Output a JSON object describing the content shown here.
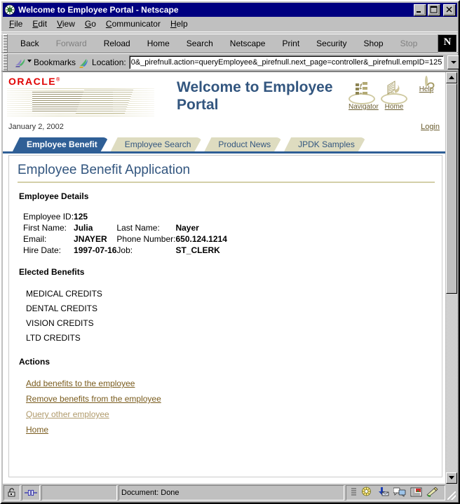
{
  "window": {
    "title": "Welcome to Employee Portal - Netscape",
    "minimize_label": "Minimize",
    "maximize_label": "Maximize",
    "close_label": "Close"
  },
  "menubar": {
    "items": [
      {
        "label": "File",
        "accel": "F"
      },
      {
        "label": "Edit",
        "accel": "E"
      },
      {
        "label": "View",
        "accel": "V"
      },
      {
        "label": "Go",
        "accel": "G"
      },
      {
        "label": "Communicator",
        "accel": "C"
      },
      {
        "label": "Help",
        "accel": "H"
      }
    ]
  },
  "toolbar": {
    "buttons": [
      {
        "label": "Back",
        "disabled": false
      },
      {
        "label": "Forward",
        "disabled": true
      },
      {
        "label": "Reload",
        "disabled": false
      },
      {
        "label": "Home",
        "disabled": false
      },
      {
        "label": "Search",
        "disabled": false
      },
      {
        "label": "Netscape",
        "disabled": false
      },
      {
        "label": "Print",
        "disabled": false
      },
      {
        "label": "Security",
        "disabled": false
      },
      {
        "label": "Shop",
        "disabled": false
      },
      {
        "label": "Stop",
        "disabled": true
      }
    ],
    "brand_letter": "N"
  },
  "locationbar": {
    "bookmarks_label": "Bookmarks",
    "location_label": "Location:",
    "url": "0&_pirefnull.action=queryEmployee&_pirefnull.next_page=controller&_pirefnull.empID=125"
  },
  "portal": {
    "brand": "ORACLE",
    "brand_tm": "®",
    "title": "Welcome to Employee Portal",
    "header_icons": [
      {
        "label": "Navigator",
        "icon": "navigator-tree-icon"
      },
      {
        "label": "Home",
        "icon": "home-icon"
      },
      {
        "label": "Help",
        "icon": "question-mark-icon"
      }
    ],
    "date": "January 2, 2002",
    "login_label": "Login",
    "tabs": [
      {
        "label": "Employee Benefit",
        "active": true
      },
      {
        "label": "Employee Search",
        "active": false
      },
      {
        "label": "Product News",
        "active": false
      },
      {
        "label": "JPDK Samples",
        "active": false
      }
    ]
  },
  "main": {
    "page_heading": "Employee Benefit Application",
    "employee_details_title": "Employee Details",
    "details": [
      [
        {
          "label": "Employee ID:",
          "value": "125"
        }
      ],
      [
        {
          "label": "First Name:",
          "value": "Julia"
        },
        {
          "label": "Last Name:",
          "value": "Nayer"
        }
      ],
      [
        {
          "label": "Email:",
          "value": "JNAYER"
        },
        {
          "label": "Phone Number:",
          "value": "650.124.1214"
        }
      ],
      [
        {
          "label": "Hire Date:",
          "value": "1997-07-16"
        },
        {
          "label": "Job:",
          "value": "ST_CLERK"
        }
      ]
    ],
    "elected_benefits_title": "Elected Benefits",
    "benefits": [
      "MEDICAL CREDITS",
      "DENTAL CREDITS",
      "VISION CREDITS",
      "LTD CREDITS"
    ],
    "actions_title": "Actions",
    "actions": [
      {
        "label": "Add benefits to the employee",
        "visited": false
      },
      {
        "label": "Remove benefits from the employee",
        "visited": false
      },
      {
        "label": "Query other employee",
        "visited": true
      },
      {
        "label": "Home",
        "visited": false
      }
    ]
  },
  "statusbar": {
    "message": "Document: Done"
  },
  "colors": {
    "titlebar": "#000080",
    "chrome": "#c0c0c0",
    "oracle_red": "#e00000",
    "portal_blue": "#33567f",
    "active_tab": "#2f5f96",
    "inactive_tab": "#dedcc0",
    "link_brown": "#7a5c1e",
    "visited_link": "#b09a6b",
    "rule_tan": "#d3cfa8"
  }
}
